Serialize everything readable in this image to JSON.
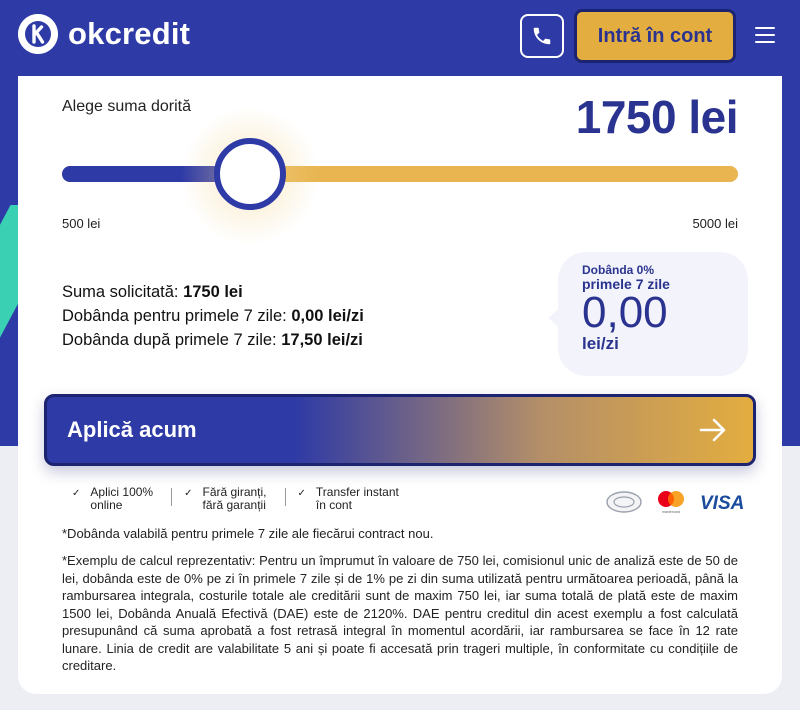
{
  "brand": {
    "name": "okcredit",
    "blue": "#2e3aa6",
    "gold": "#e3ad3f",
    "teal": "#3ad0b4"
  },
  "header": {
    "phone_icon": "phone-icon",
    "login_label": "Intră în cont",
    "menu_icon": "hamburger-menu-icon"
  },
  "calculator": {
    "label": "Alege suma dorită",
    "amount_display": "1750 lei",
    "slider": {
      "min": 500,
      "max": 5000,
      "value": 1750
    },
    "min_label": "500 lei",
    "max_label": "5000 lei"
  },
  "summary": {
    "requested_label": "Suma solicitată:",
    "requested_value": "1750 lei",
    "interest7_label": "Dobânda pentru primele 7 zile:",
    "interest7_value": "0,00 lei/zi",
    "interest_after_label": "Dobânda după primele 7 zile:",
    "interest_after_value": "17,50 lei/zi"
  },
  "interest_box": {
    "title": "Dobânda 0%",
    "subtitle": "primele 7 zile",
    "value": "0,00",
    "unit": "lei/zi"
  },
  "apply": {
    "label": "Aplică acum",
    "icon": "arrow-right-icon"
  },
  "features": [
    {
      "line1": "Aplici 100%",
      "line2": "online"
    },
    {
      "line1": "Fără giranți,",
      "line2": "fără garanții"
    },
    {
      "line1": "Transfer instant",
      "line2": "în cont"
    }
  ],
  "payments": [
    "generic-card-icon",
    "mastercard-icon",
    "visa-icon"
  ],
  "payment_labels": {
    "mastercard": "mastercard",
    "visa": "VISA"
  },
  "footnote": "*Dobânda valabilă pentru primele 7 zile ale fiecărui contract nou.",
  "example": "*Exemplu de calcul reprezentativ: Pentru un împrumut în valoare de 750 lei, comisionul unic de analiză este de 50 de lei, dobânda este de 0% pe zi în primele 7 zile și de 1% pe zi din suma utilizată pentru următoarea perioadă, până la rambursarea integrala, costurile totale ale creditării sunt de maxim 750 lei, iar suma totală de plată este de maxim 1500 lei, Dobânda Anuală Efectivă (DAE) este de 2120%. DAE pentru creditul din acest exemplu a fost calculată presupunând că suma aprobată a fost retrasă integral în momentul acordării, iar rambursarea se face în 12 rate lunare. Linia de credit are valabilitate 5 ani și poate fi accesată prin trageri multiple, în conformitate cu condițiile de creditare."
}
